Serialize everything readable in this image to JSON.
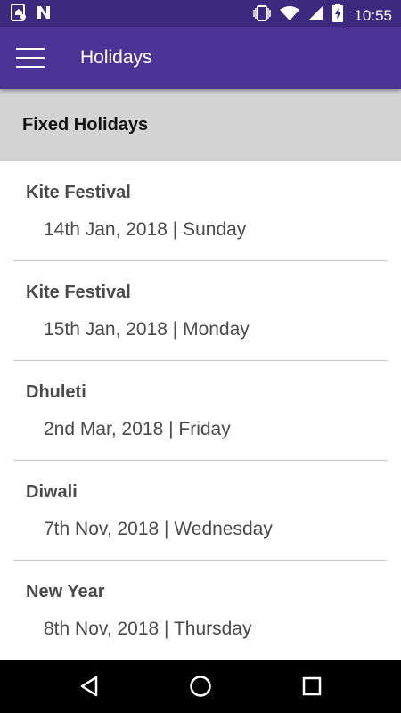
{
  "status_bar": {
    "time": "10:55",
    "icons": [
      "notification-sim-icon",
      "n-logo-icon",
      "vibrate-icon",
      "wifi-icon",
      "signal-icon",
      "battery-charging-icon"
    ]
  },
  "app_bar": {
    "title": "Holidays",
    "menu_icon": "hamburger-menu-icon"
  },
  "section": {
    "title": "Fixed Holidays"
  },
  "holidays": [
    {
      "name": "Kite Festival",
      "date": "14th Jan, 2018 | Sunday"
    },
    {
      "name": "Kite Festival",
      "date": "15th Jan, 2018 | Monday"
    },
    {
      "name": "Dhuleti",
      "date": "2nd Mar, 2018 | Friday"
    },
    {
      "name": "Diwali",
      "date": "7th Nov, 2018 | Wednesday"
    },
    {
      "name": "New Year",
      "date": "8th Nov, 2018 | Thursday"
    }
  ],
  "nav_bar": {
    "icons": [
      "back-icon",
      "home-icon",
      "recents-icon"
    ]
  },
  "colors": {
    "status_bar": "#3b2a7e",
    "app_bar": "#4b3496",
    "section_header": "#d3d3d3",
    "nav_bar": "#000000"
  }
}
